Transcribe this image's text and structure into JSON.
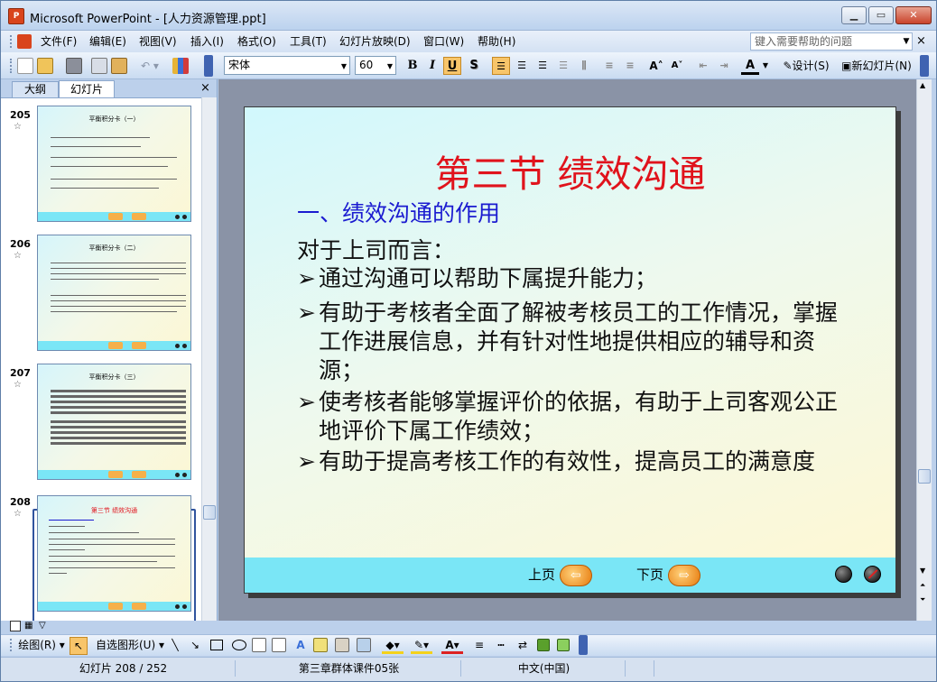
{
  "window": {
    "title": "Microsoft PowerPoint - [人力资源管理.ppt]",
    "app_icon_label": "P"
  },
  "menu": {
    "items": [
      "文件(F)",
      "编辑(E)",
      "视图(V)",
      "插入(I)",
      "格式(O)",
      "工具(T)",
      "幻灯片放映(D)",
      "窗口(W)",
      "帮助(H)"
    ],
    "help_placeholder": "键入需要帮助的问题"
  },
  "toolbar": {
    "font_name": "宋体",
    "font_size": "60",
    "bold": "B",
    "italic": "I",
    "underline": "U",
    "shadow": "S",
    "design_label": "设计(S)",
    "new_slide_label": "新幻灯片(N)"
  },
  "left_panel": {
    "tab_outline": "大纲",
    "tab_slides": "幻灯片",
    "close": "×",
    "slides": [
      {
        "number": "205",
        "title": "平衡积分卡（一）"
      },
      {
        "number": "206",
        "title": "平衡积分卡（二）"
      },
      {
        "number": "207",
        "title": "平衡积分卡（三）"
      },
      {
        "number": "208",
        "title": "第三节 绩效沟通"
      }
    ],
    "star": "☆"
  },
  "slide": {
    "title": "第三节 绩效沟通",
    "subtitle": "一、绩效沟通的作用",
    "intro": "对于上司而言：",
    "bullet_marker": "➢",
    "bullets": [
      "通过沟通可以帮助下属提升能力；",
      "有助于考核者全面了解被考核员工的工作情况，掌握工作进展信息，并有针对性地提供相应的辅导和资源；",
      "使考核者能够掌握评价的依据，有助于上司客观公正地评价下属工作绩效；",
      "有助于提高考核工作的有效性，提高员工的满意度"
    ],
    "prev_label": "上页",
    "next_label": "下页"
  },
  "drawbar": {
    "draw_label": "绘图(R)",
    "autoshape_label": "自选图形(U)"
  },
  "status": {
    "slide_info": "幻灯片 208 / 252",
    "template": "第三章群体课件05张",
    "language": "中文(中国)"
  },
  "colors": {
    "title_red": "#e0131c",
    "subtitle_blue": "#1b1bd0",
    "nav_bar": "#7ae6f6",
    "nav_button": "#e77b0e"
  }
}
